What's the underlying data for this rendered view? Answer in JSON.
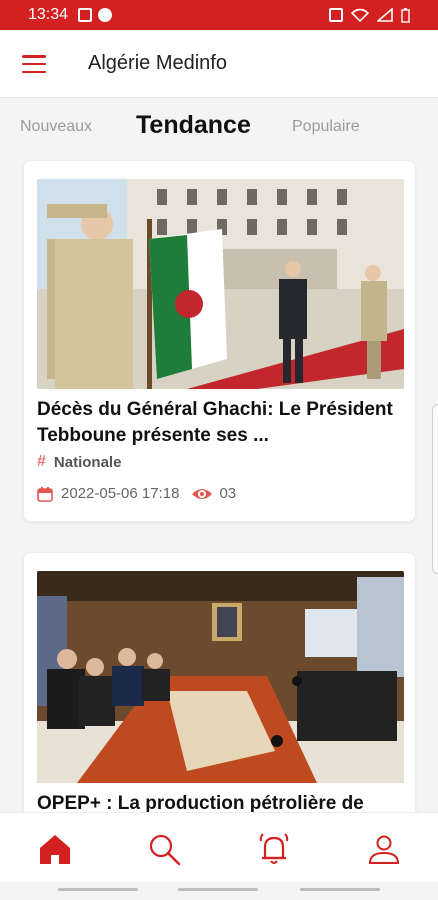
{
  "status_bar": {
    "time": "13:34"
  },
  "app": {
    "title": "Algérie Medinfo"
  },
  "tabs": [
    {
      "label": "Nouveaux",
      "active": false
    },
    {
      "label": "Tendance",
      "active": true
    },
    {
      "label": "Populaire",
      "active": false
    }
  ],
  "articles": [
    {
      "title": "Décès du Général Ghachi: Le Président Tebboune présente ses ...",
      "category": "Nationale",
      "date": "2022-05-06 17:18",
      "views": "03"
    },
    {
      "title": "OPEP+ : La production pétrolière de"
    }
  ],
  "bottom_nav": [
    {
      "icon": "home-icon",
      "active": true
    },
    {
      "icon": "search-icon",
      "active": false
    },
    {
      "icon": "bell-icon",
      "active": false
    },
    {
      "icon": "user-icon",
      "active": false
    }
  ],
  "colors": {
    "accent": "#d32020",
    "category_hash": "#e8736f"
  }
}
